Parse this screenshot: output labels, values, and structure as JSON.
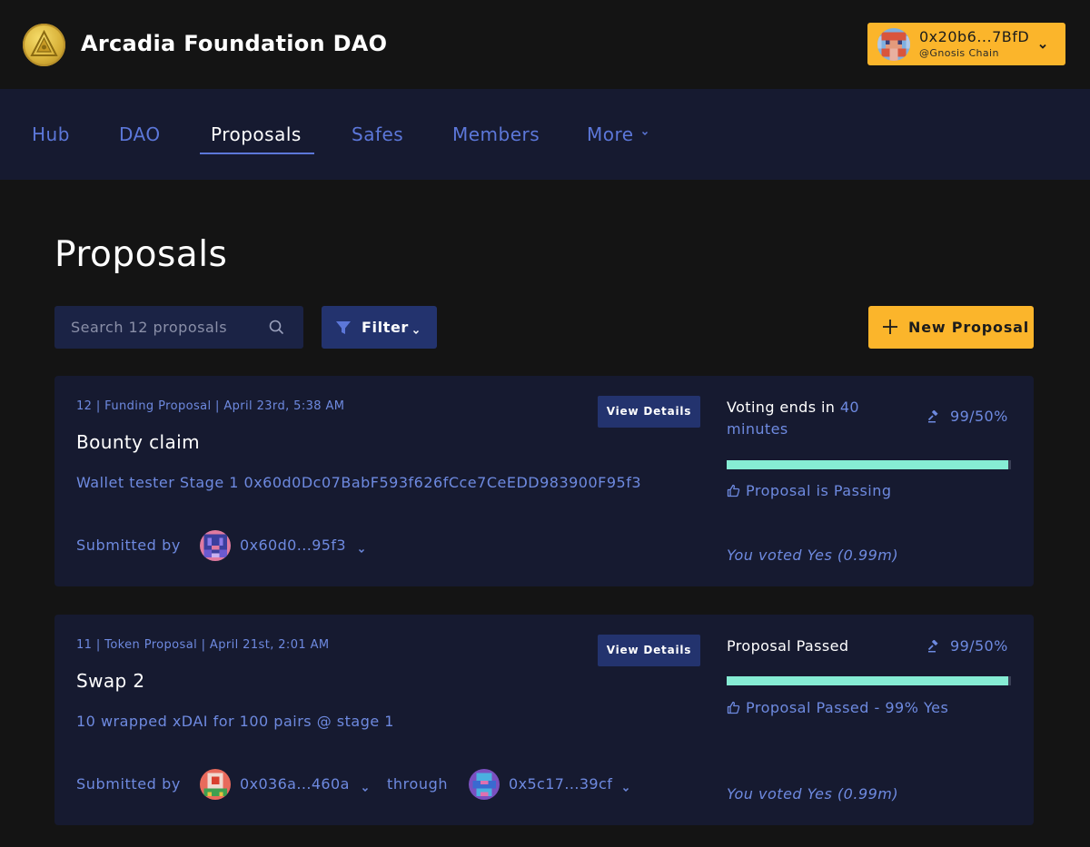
{
  "app": {
    "title": "Arcadia Foundation DAO"
  },
  "wallet": {
    "address": "0x20b6...7BfD",
    "chain": "@Gnosis Chain"
  },
  "nav": {
    "items": [
      {
        "label": "Hub"
      },
      {
        "label": "DAO"
      },
      {
        "label": "Proposals"
      },
      {
        "label": "Safes"
      },
      {
        "label": "Members"
      },
      {
        "label": "More"
      }
    ],
    "active": "Proposals"
  },
  "page": {
    "title": "Proposals"
  },
  "search": {
    "placeholder": "Search 12 proposals"
  },
  "filter": {
    "label": "Filter"
  },
  "new_proposal": {
    "label": "New Proposal"
  },
  "proposals": [
    {
      "meta": "12 | Funding Proposal | April 23rd, 5:38 AM",
      "title": "Bounty claim",
      "description": "Wallet tester Stage 1 0x60d0Dc07BabF593f626fCce7CeEDD983900F95f3",
      "view_label": "View Details",
      "submitted_label": "Submitted by",
      "submitter": "0x60d0...95f3",
      "status_prefix": "Voting ends in",
      "status_highlight": "40 minutes",
      "quorum": "99/50%",
      "progress": 0.99,
      "result": "Proposal is Passing",
      "voted": "You voted Yes (0.99m)"
    },
    {
      "meta": "11 | Token Proposal | April 21st, 2:01 AM",
      "title": "Swap 2",
      "description": "10 wrapped xDAI for 100 pairs @ stage 1",
      "view_label": "View Details",
      "submitted_label": "Submitted by",
      "submitter": "0x036a...460a",
      "through_label": "through",
      "through": "0x5c17...39cf",
      "status_prefix": "Proposal Passed",
      "quorum": "99/50%",
      "progress": 0.99,
      "result": "Proposal Passed - 99% Yes",
      "voted": "You voted Yes (0.99m)"
    }
  ],
  "colors": {
    "accent": "#5c77d9",
    "gold": "#fbb52b",
    "progress": "#86ecd4",
    "card": "#161a30",
    "background": "#141414"
  }
}
